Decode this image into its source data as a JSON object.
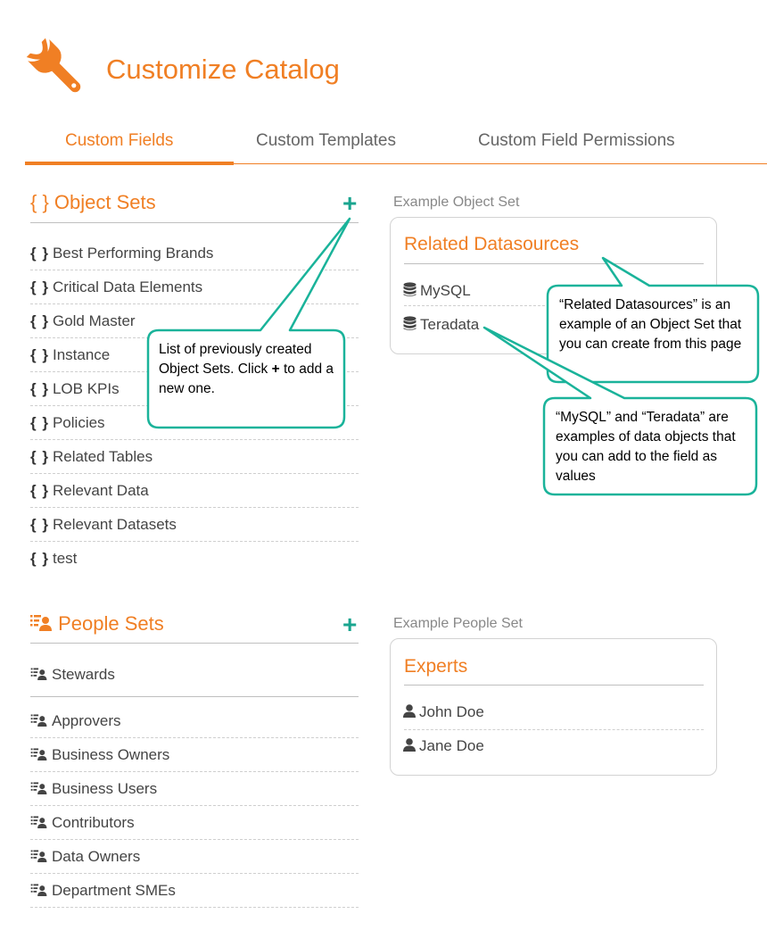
{
  "header": {
    "title": "Customize Catalog",
    "icon": "wrench-icon",
    "accent": "#f07f24"
  },
  "tabs": [
    {
      "label": "Custom Fields",
      "active": true
    },
    {
      "label": "Custom Templates",
      "active": false
    },
    {
      "label": "Custom Field Permissions",
      "active": false
    }
  ],
  "object_sets": {
    "title": "{ } Object Sets",
    "add_label": "+",
    "icon": "braces-icon",
    "items": [
      "Best Performing Brands",
      "Critical Data Elements",
      "Gold Master",
      "Instance",
      "LOB KPIs",
      "Policies",
      "Related Tables",
      "Relevant Data",
      "Relevant Datasets",
      "test"
    ]
  },
  "example_object_set": {
    "label": "Example Object Set",
    "card_title": "Related Datasources",
    "items": [
      "MySQL",
      "Teradata"
    ],
    "item_icon": "database-icon"
  },
  "people_sets": {
    "title": "People Sets",
    "add_label": "+",
    "icon": "people-list-icon",
    "default_item": "Stewards",
    "items": [
      "Approvers",
      "Business Owners",
      "Business Users",
      "Contributors",
      "Data Owners",
      "Department SMEs"
    ]
  },
  "example_people_set": {
    "label": "Example People Set",
    "card_title": "Experts",
    "items": [
      "John Doe",
      "Jane Doe"
    ],
    "item_icon": "user-icon"
  },
  "callouts": {
    "object_sets_pre": "List of previously created Object Sets. Click ",
    "object_sets_plus": "+",
    "object_sets_post": " to add a new one.",
    "related_datasources": "“Related Datasources” is an example of an Object Set that you can create from this page",
    "mysql_teradata": "“MySQL” and “Teradata” are examples of data objects that you can add to the field as values"
  },
  "colors": {
    "accent": "#f07f24",
    "callout_border": "#1ab39a",
    "plus": "#1aa58f"
  }
}
